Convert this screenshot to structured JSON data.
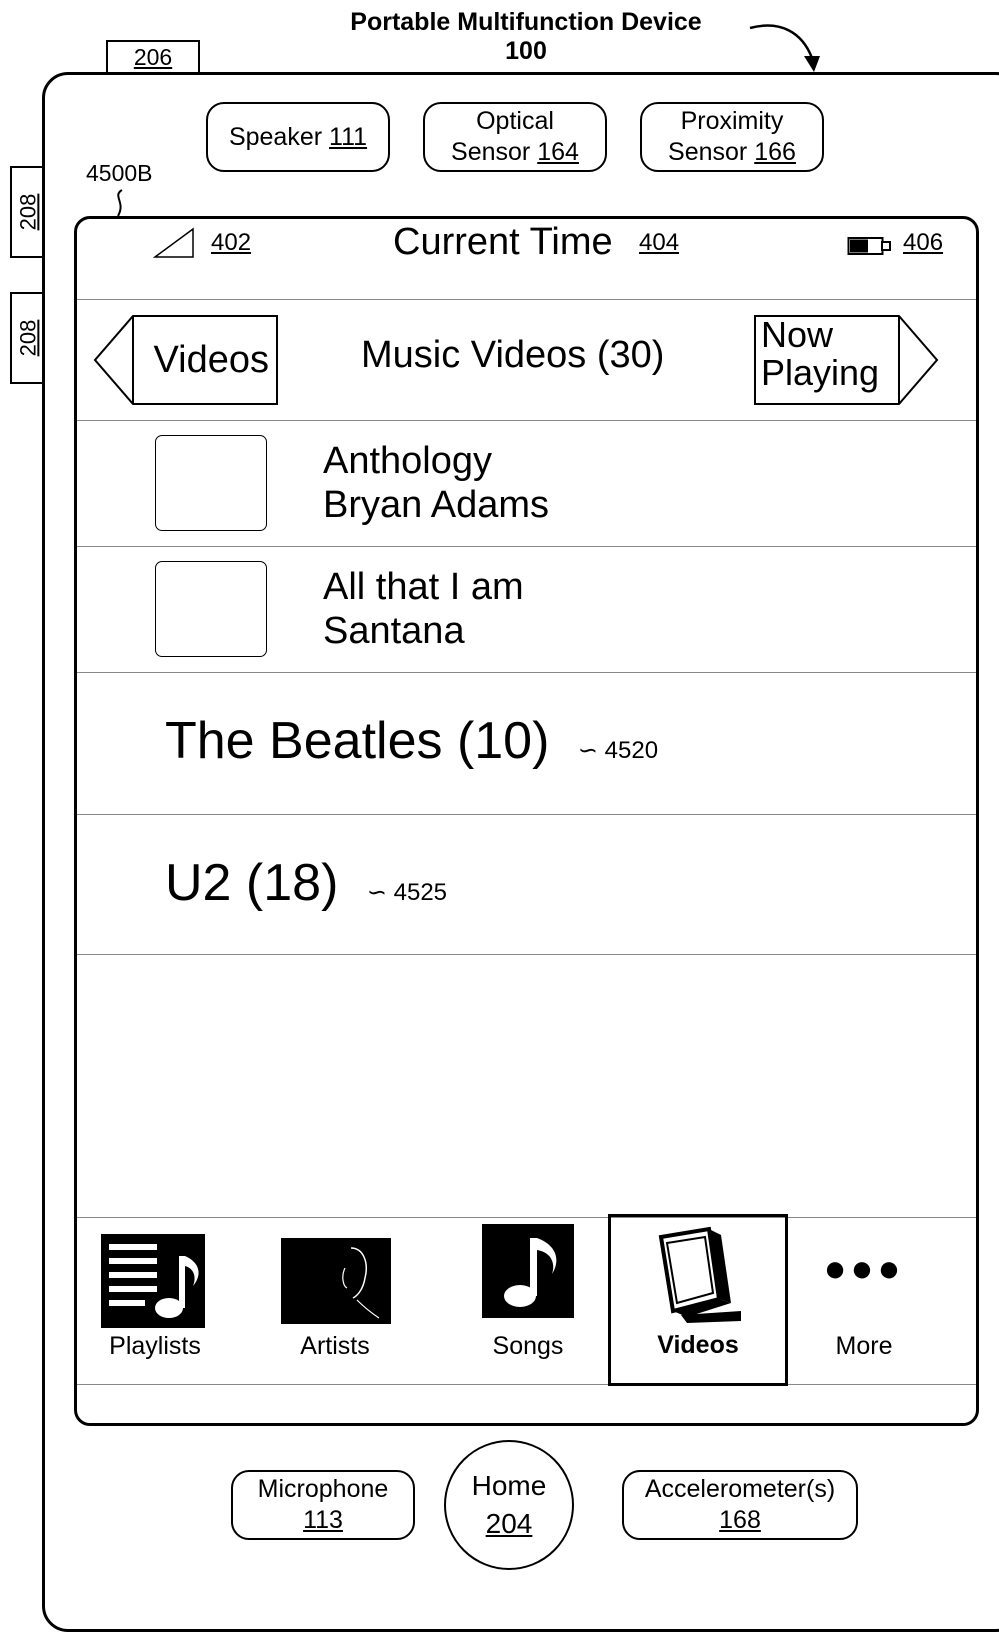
{
  "figure": {
    "title": "Portable Multifunction Device",
    "number": "100",
    "ref_206": "206",
    "ref_208a": "208",
    "ref_208b": "208",
    "screen_ref": "4500B"
  },
  "hardware": {
    "speaker": {
      "label": "Speaker",
      "ref": "111"
    },
    "optical_sensor": {
      "line1": "Optical",
      "line2": "Sensor",
      "ref": "164"
    },
    "proximity_sensor": {
      "line1": "Proximity",
      "line2": "Sensor",
      "ref": "166"
    },
    "microphone": {
      "label": "Microphone",
      "ref": "113"
    },
    "home": {
      "label": "Home",
      "ref": "204"
    },
    "accelerometer": {
      "label": "Accelerometer(s)",
      "ref": "168"
    }
  },
  "status_bar": {
    "signal_ref": "402",
    "time_label": "Current Time",
    "time_ref": "404",
    "battery_ref": "406"
  },
  "nav_bar": {
    "back_label": "Videos",
    "title": "Music Videos (30)",
    "now_playing_line1": "Now",
    "now_playing_line2": "Playing"
  },
  "videos": [
    {
      "title": "Anthology",
      "artist": "Bryan Adams"
    },
    {
      "title": "All that I am",
      "artist": "Santana"
    }
  ],
  "groups": [
    {
      "label": "The Beatles (10)",
      "ref": "4520"
    },
    {
      "label": "U2 (18)",
      "ref": "4525"
    }
  ],
  "tabs": [
    {
      "label": "Playlists",
      "icon": "playlists-icon",
      "selected": false
    },
    {
      "label": "Artists",
      "icon": "artists-icon",
      "selected": false
    },
    {
      "label": "Songs",
      "icon": "songs-icon",
      "selected": false
    },
    {
      "label": "Videos",
      "icon": "videos-icon",
      "selected": true
    },
    {
      "label": "More",
      "icon": "more-icon",
      "selected": false
    }
  ]
}
